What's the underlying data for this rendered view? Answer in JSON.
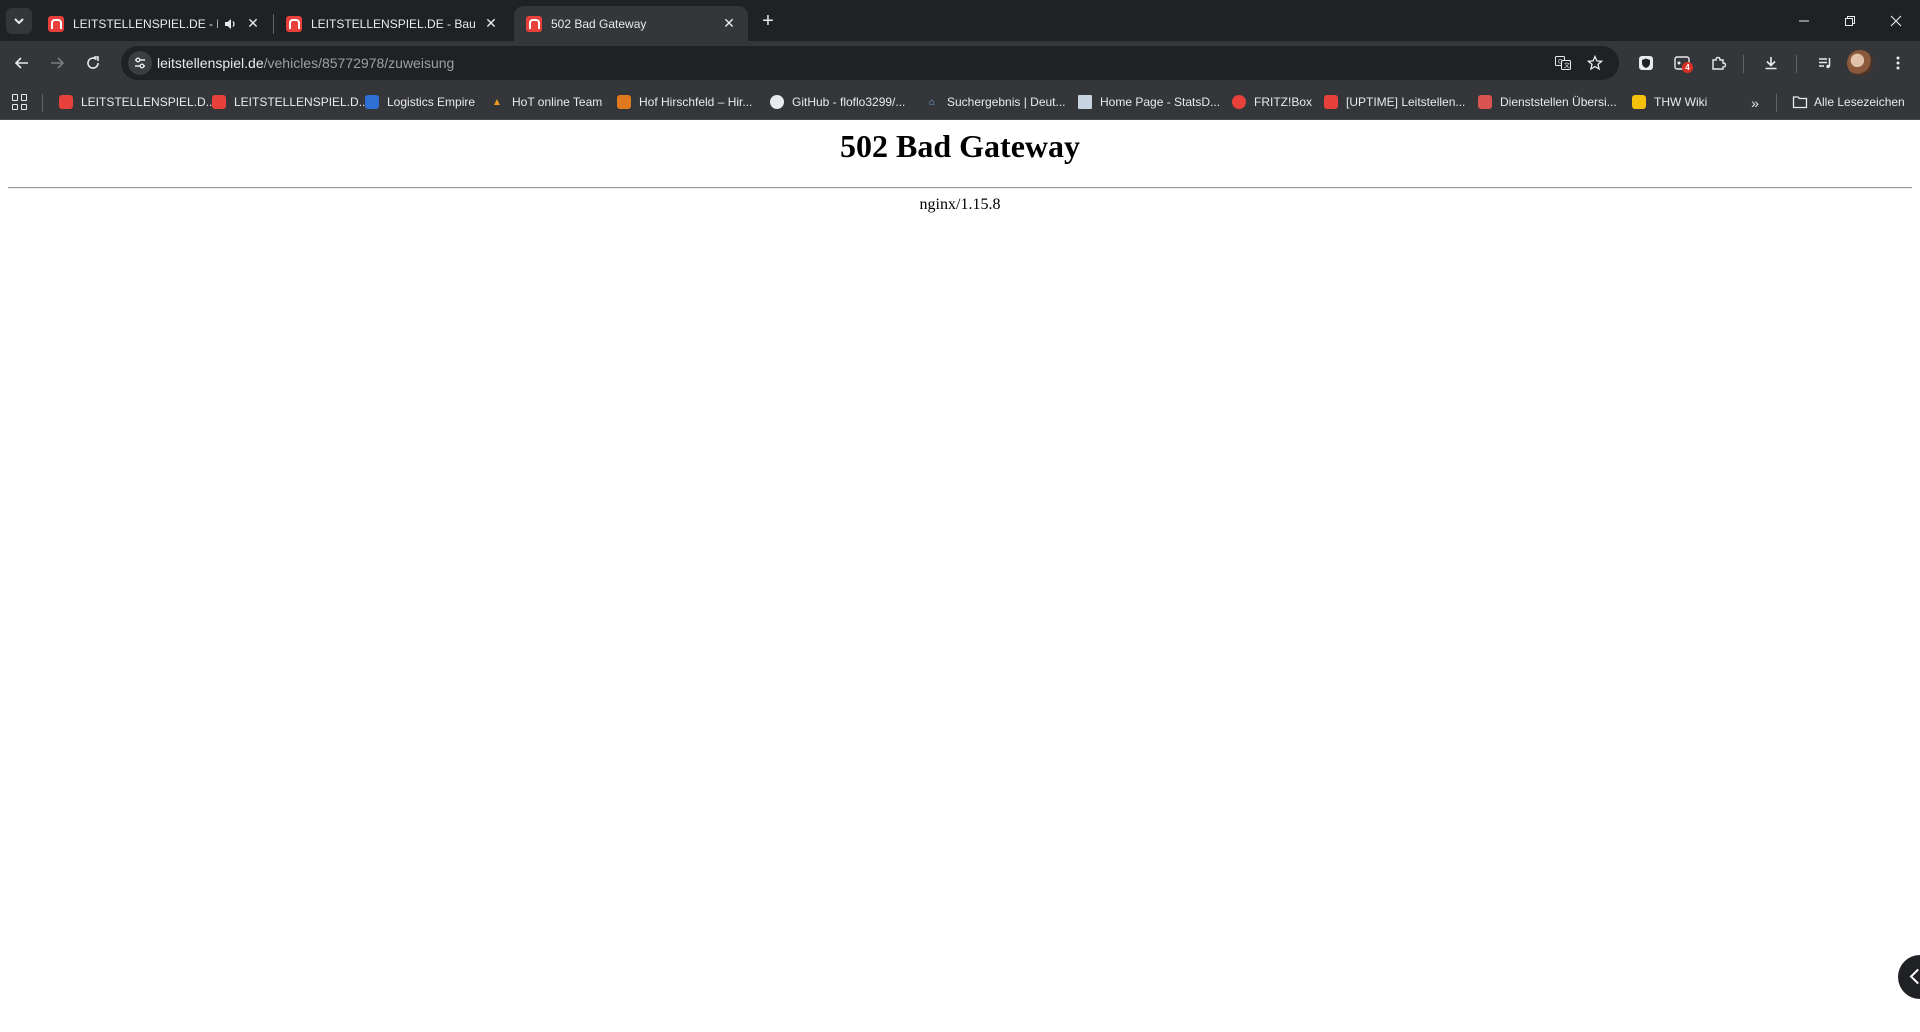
{
  "browser": {
    "tabs": [
      {
        "title": "LEITSTELLENSPIEL.DE - Baue",
        "has_audio": true
      },
      {
        "title": "LEITSTELLENSPIEL.DE - Baue de",
        "has_audio": false
      },
      {
        "title": "502 Bad Gateway",
        "active": true
      }
    ],
    "address_bar": {
      "host": "leitstellenspiel.de",
      "path": "/vehicles/85772978/zuweisung"
    },
    "extension_badge_count": "4",
    "bookmarks": [
      {
        "label": "LEITSTELLENSPIEL.D...",
        "icon": "leitstellenspiel-icon",
        "color": "#e8403a"
      },
      {
        "label": "LEITSTELLENSPIEL.D...",
        "icon": "leitstellenspiel-icon",
        "color": "#e8403a"
      },
      {
        "label": "Logistics Empire",
        "icon": "logistics-empire-icon",
        "color": "#2f6fd6"
      },
      {
        "label": "HoT online Team",
        "icon": "hot-icon",
        "color": "#f29a1a"
      },
      {
        "label": "Hof Hirschfeld – Hir...",
        "icon": "hof-hirschfeld-icon",
        "color": "#e07a1f"
      },
      {
        "label": "GitHub - floflo3299/...",
        "icon": "github-icon",
        "color": "#e8eaed"
      },
      {
        "label": "Suchergebnis | Deut...",
        "icon": "house-icon",
        "color": "#7fb2f0"
      },
      {
        "label": "Home Page - StatsD...",
        "icon": "document-icon",
        "color": "#c9d4e3"
      },
      {
        "label": "FRITZ!Box",
        "icon": "fritzbox-icon",
        "color": "#e8403a"
      },
      {
        "label": "[UPTIME] Leitstellen...",
        "icon": "uptime-icon",
        "color": "#e8403a"
      },
      {
        "label": "Dienststellen Übersi...",
        "icon": "dienststellen-icon",
        "color": "#d9534f"
      },
      {
        "label": "THW Wiki",
        "icon": "thw-icon",
        "color": "#f4c20d"
      }
    ],
    "all_bookmarks_label": "Alle Lesezeichen"
  },
  "page": {
    "heading": "502 Bad Gateway",
    "server": "nginx/1.15.8"
  }
}
